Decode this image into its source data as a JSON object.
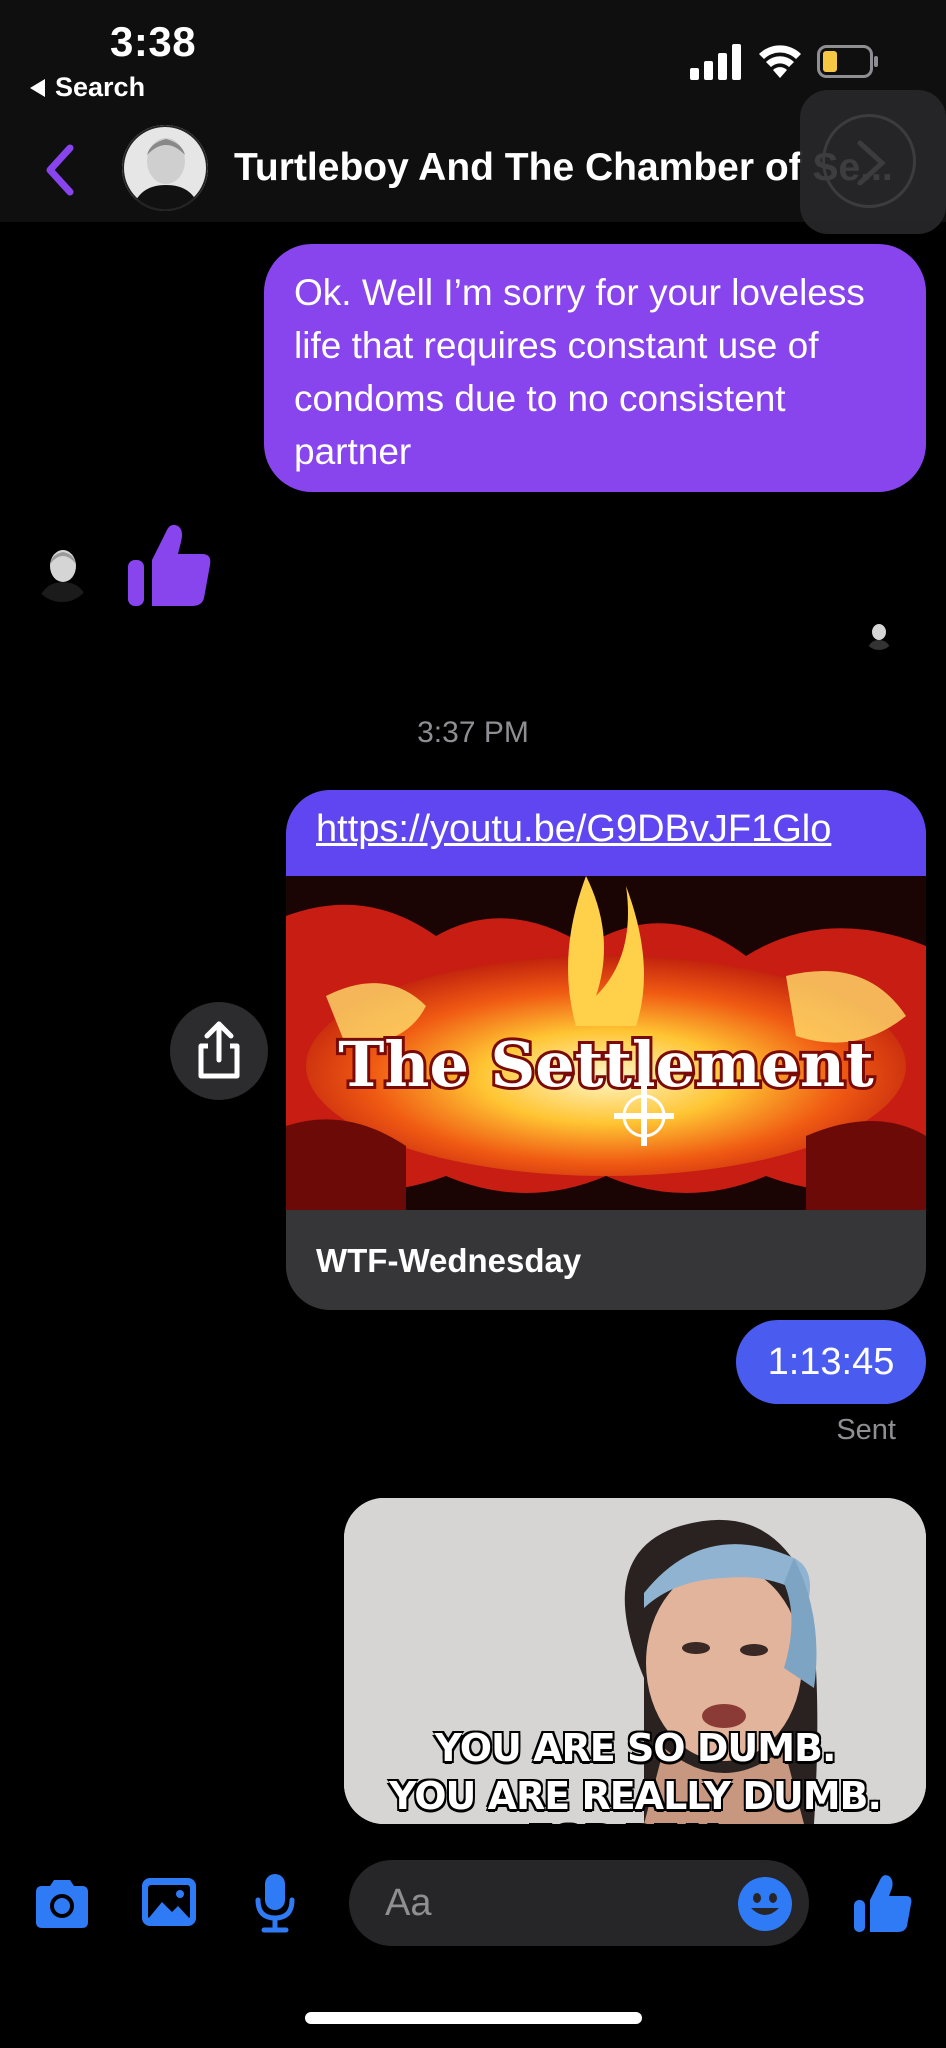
{
  "status_bar": {
    "time": "3:38",
    "back_app": "Search"
  },
  "header": {
    "title": "Turtleboy And The Chamber of Se..."
  },
  "messages": {
    "outgoing_text": "Ok. Well I’m sorry for your loveless life that requires constant use of condoms due to no consistent partner",
    "timestamp": "3:37 PM",
    "link": {
      "url": "https://youtu.be/G9DBvJF1Glo",
      "preview_title_art": "The Settlement",
      "preview_source": "WTF-Wednesday"
    },
    "time_message": "1:13:45",
    "status": "Sent",
    "gif_caption_line1": "YOU ARE SO DUMB.",
    "gif_caption_line2": "YOU ARE REALLY DUMB. FOR REAL."
  },
  "composer": {
    "placeholder": "Aa"
  },
  "colors": {
    "accent_purple": "#8845ee",
    "link_blue": "#6046f0",
    "time_blue": "#4a5cf0",
    "icon_blue": "#2f7bf6"
  }
}
